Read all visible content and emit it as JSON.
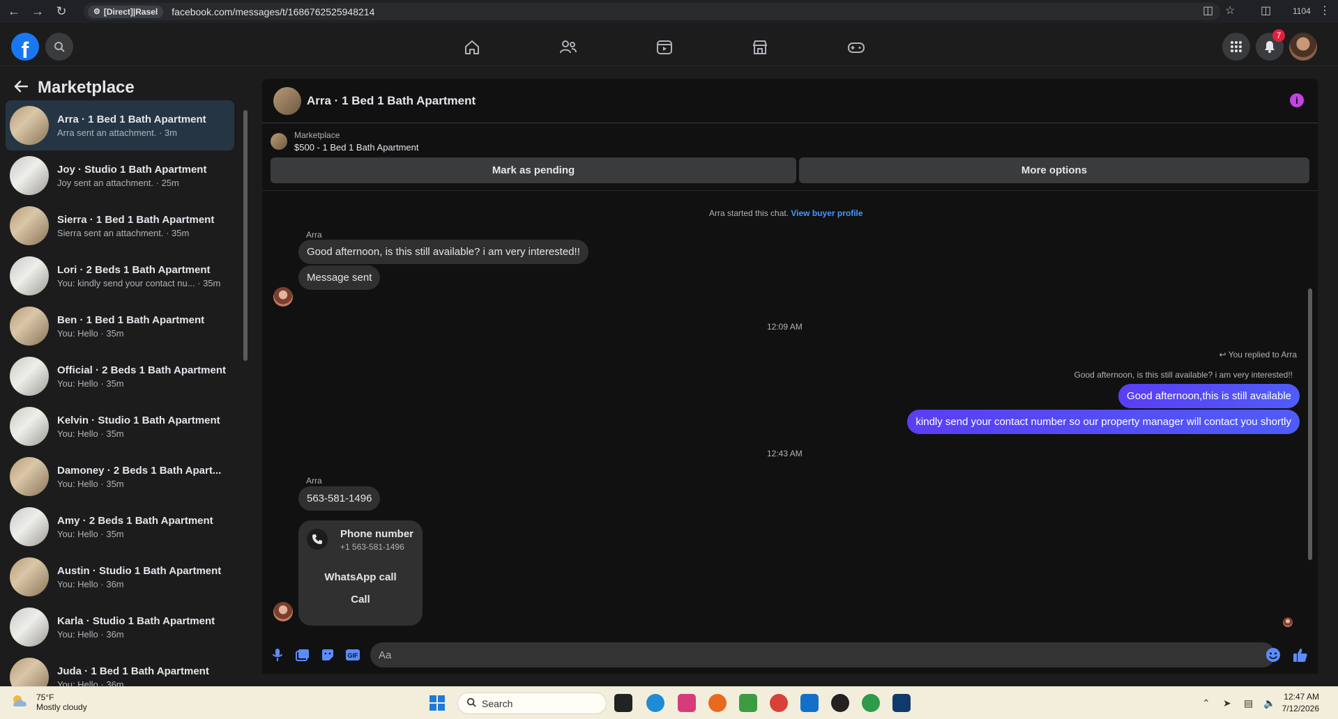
{
  "browser": {
    "profile_chip": "[Direct]|Rasel",
    "url": "facebook.com/messages/t/1686762525948214",
    "window_number": "1104"
  },
  "fb_nav": {
    "notification_count": "7"
  },
  "sidebar": {
    "title": "Marketplace",
    "conversations": [
      {
        "name": "Arra · 1 Bed 1 Bath Apartment",
        "subtitle": "Arra sent an attachment. · 3m"
      },
      {
        "name": "Joy · Studio 1 Bath Apartment",
        "subtitle": "Joy sent an attachment. · 25m"
      },
      {
        "name": "Sierra · 1 Bed 1 Bath Apartment",
        "subtitle": "Sierra sent an attachment. · 35m"
      },
      {
        "name": "Lori · 2 Beds 1 Bath Apartment",
        "subtitle": "You: kindly send your contact nu... · 35m"
      },
      {
        "name": "Ben · 1 Bed 1 Bath Apartment",
        "subtitle": "You: Hello · 35m"
      },
      {
        "name": "Official · 2 Beds 1 Bath Apartment",
        "subtitle": "You: Hello · 35m"
      },
      {
        "name": "Kelvin · Studio 1 Bath Apartment",
        "subtitle": "You: Hello · 35m"
      },
      {
        "name": "Damoney · 2 Beds 1 Bath Apart...",
        "subtitle": "You: Hello · 35m"
      },
      {
        "name": "Amy · 2 Beds 1 Bath Apartment",
        "subtitle": "You: Hello · 35m"
      },
      {
        "name": "Austin · Studio 1 Bath Apartment",
        "subtitle": "You: Hello · 36m"
      },
      {
        "name": "Karla · Studio 1 Bath Apartment",
        "subtitle": "You: Hello · 36m"
      },
      {
        "name": "Juda · 1 Bed 1 Bath Apartment",
        "subtitle": "You: Hello · 36m"
      }
    ]
  },
  "chat": {
    "title": "Arra · 1 Bed 1 Bath Apartment",
    "marketplace_label": "Marketplace",
    "listing": "$500 - 1 Bed 1 Bath Apartment",
    "mark_pending": "Mark as pending",
    "more_options": "More options",
    "started_text": "Arra started this chat.",
    "view_buyer": "View buyer profile",
    "sender1": "Arra",
    "msg1": "Good afternoon, is this still available? i am very interested!!",
    "msg2": "Message sent",
    "time1": "12:09 AM",
    "replied_to": "You replied to Arra",
    "quoted": "Good afternoon, is this still available? i am very interested!!",
    "out1": "Good afternoon,this is still available",
    "out2": "kindly send your contact number so our property manager will contact you shortly",
    "time2": "12:43 AM",
    "sender2": "Arra",
    "msg3": "563-581-1496",
    "phone_title": "Phone number",
    "phone_value": "+1 563-581-1496",
    "whatsapp": "WhatsApp call",
    "call": "Call",
    "input_placeholder": "Aa"
  },
  "taskbar": {
    "temperature": "75°F",
    "weather": "Mostly cloudy",
    "search": "Search",
    "time": "12:47 AM",
    "date": "7/12/2026"
  }
}
